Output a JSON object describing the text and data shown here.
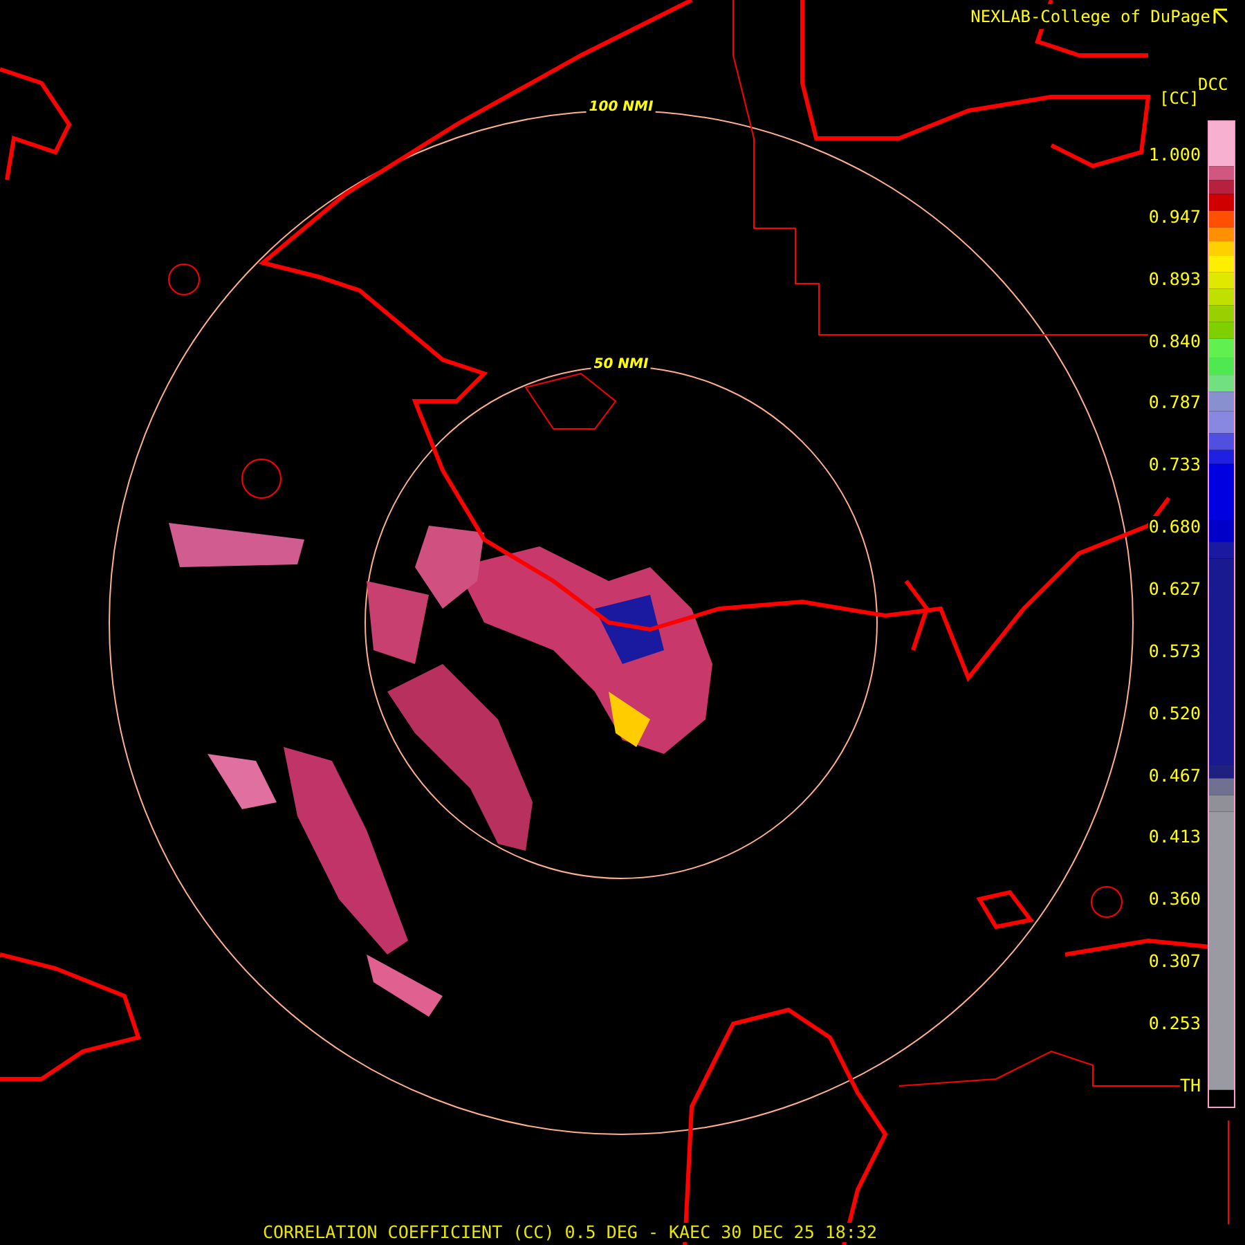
{
  "header": {
    "credit": "NEXLAB-College of DuPage"
  },
  "legend": {
    "product": "DCC",
    "unit": "[CC]",
    "labels": [
      "1.000",
      "0.947",
      "0.893",
      "0.840",
      "0.787",
      "0.733",
      "0.680",
      "0.627",
      "0.573",
      "0.520",
      "0.467",
      "0.413",
      "0.360",
      "0.307",
      "0.253",
      "TH"
    ]
  },
  "range_rings": [
    {
      "label": "100 NMI"
    },
    {
      "label": "50 NMI"
    }
  ],
  "footer": {
    "title": "CORRELATION COEFFICIENT (CC) 0.5 DEG - KAEC 30 DEC 25 18:32"
  }
}
